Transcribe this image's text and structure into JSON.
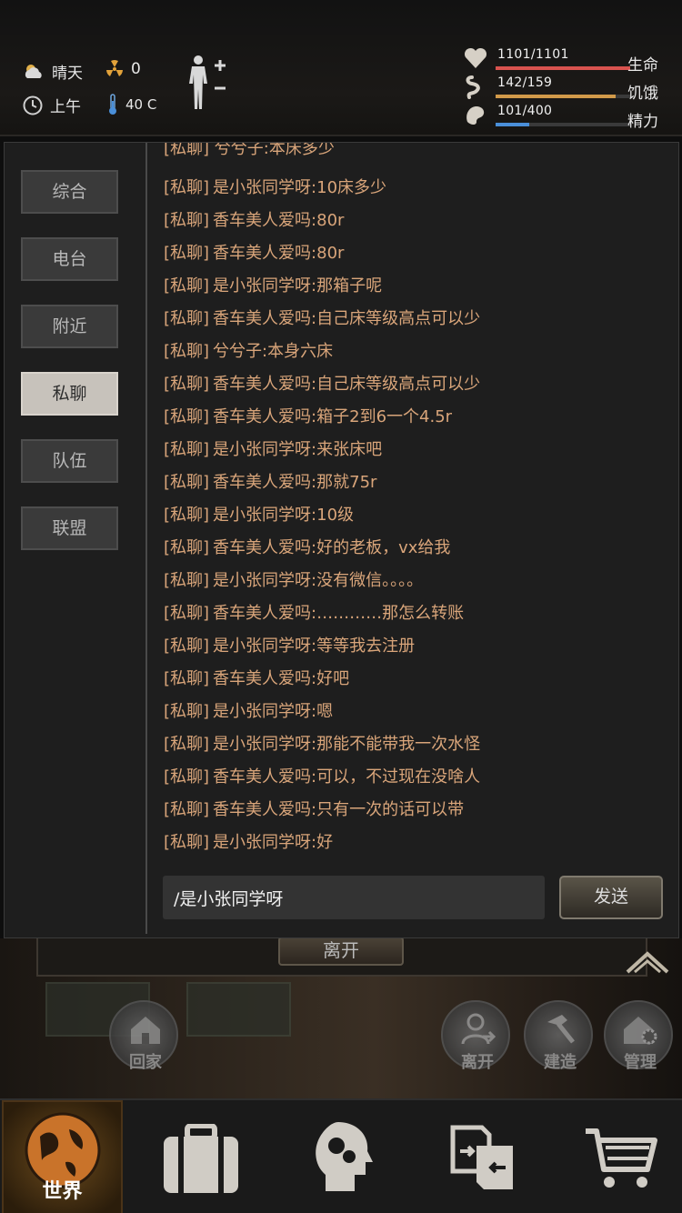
{
  "status": {
    "weather": "晴天",
    "radiation": "0",
    "time_of_day": "上午",
    "temperature": "40 C"
  },
  "vitals": [
    {
      "name": "生命",
      "value": "1101/1101",
      "fraction": 1.0,
      "color": "#d9534f",
      "icon": "heart-icon"
    },
    {
      "name": "饥饿",
      "value": "142/159",
      "fraction": 0.89,
      "color": "#d29a4a",
      "icon": "stomach-icon"
    },
    {
      "name": "精力",
      "value": "101/400",
      "fraction": 0.25,
      "color": "#4a8fd9",
      "icon": "energy-icon"
    }
  ],
  "chat": {
    "tabs": [
      "综合",
      "电台",
      "附近",
      "私聊",
      "队伍",
      "联盟"
    ],
    "active_tab": "私聊",
    "partial_top_line": "[私聊] 兮兮子:本床多少",
    "messages": [
      {
        "tag": "[私聊]",
        "text": "是小张同学呀:10床多少"
      },
      {
        "tag": "[私聊]",
        "text": "香车美人爱吗:80r"
      },
      {
        "tag": "[私聊]",
        "text": "香车美人爱吗:80r"
      },
      {
        "tag": "[私聊]",
        "text": "是小张同学呀:那箱子呢"
      },
      {
        "tag": "[私聊]",
        "text": "香车美人爱吗:自己床等级高点可以少"
      },
      {
        "tag": "[私聊]",
        "text": "兮兮子:本身六床"
      },
      {
        "tag": "[私聊]",
        "text": "香车美人爱吗:自己床等级高点可以少"
      },
      {
        "tag": "[私聊]",
        "text": "香车美人爱吗:箱子2到6一个4.5r"
      },
      {
        "tag": "[私聊]",
        "text": "是小张同学呀:来张床吧"
      },
      {
        "tag": "[私聊]",
        "text": "香车美人爱吗:那就75r"
      },
      {
        "tag": "[私聊]",
        "text": "是小张同学呀:10级"
      },
      {
        "tag": "[私聊]",
        "text": "香车美人爱吗:好的老板，vx给我"
      },
      {
        "tag": "[私聊]",
        "text": "是小张同学呀:没有微信。。。。"
      },
      {
        "tag": "[私聊]",
        "text": "香车美人爱吗:…………那怎么转账"
      },
      {
        "tag": "[私聊]",
        "text": "是小张同学呀:等等我去注册"
      },
      {
        "tag": "[私聊]",
        "text": "香车美人爱吗:好吧"
      },
      {
        "tag": "[私聊]",
        "text": "是小张同学呀:嗯"
      },
      {
        "tag": "[私聊]",
        "text": "是小张同学呀:那能不能带我一次水怪"
      },
      {
        "tag": "[私聊]",
        "text": "香车美人爱吗:可以，不过现在没啥人"
      },
      {
        "tag": "[私聊]",
        "text": "香车美人爱吗:只有一次的话可以带"
      },
      {
        "tag": "[私聊]",
        "text": "是小张同学呀:好"
      }
    ],
    "input_value": "/是小张同学呀",
    "send_label": "发送"
  },
  "scene": {
    "leave_tab_label": "离开",
    "buttons": [
      {
        "label": "回家",
        "icon": "home-icon"
      },
      {
        "label": "离开",
        "icon": "person-leave-icon"
      },
      {
        "label": "建造",
        "icon": "hammer-icon"
      },
      {
        "label": "管理",
        "icon": "home-gear-icon"
      }
    ]
  },
  "bottom_nav": {
    "items": [
      {
        "label": "世界",
        "icon": "globe-icon",
        "active": true
      },
      {
        "label": "",
        "icon": "briefcase-icon",
        "active": false
      },
      {
        "label": "",
        "icon": "head-gears-icon",
        "active": false
      },
      {
        "label": "",
        "icon": "exchange-icon",
        "active": false
      },
      {
        "label": "",
        "icon": "shopping-cart-icon",
        "active": false
      }
    ]
  }
}
